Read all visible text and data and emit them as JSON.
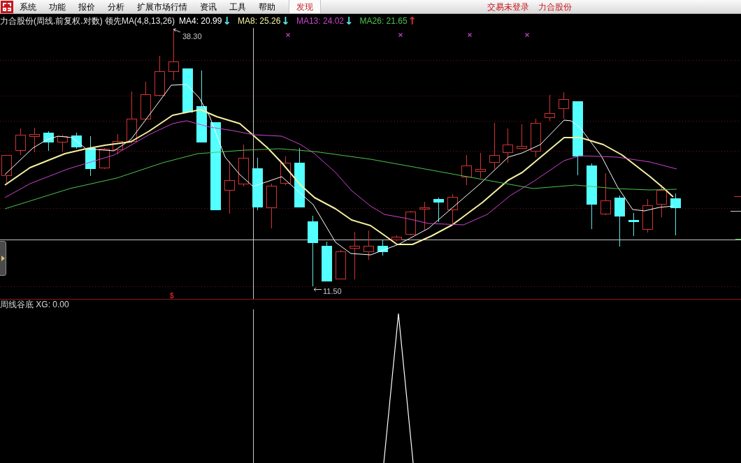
{
  "menu_bar": {
    "items": [
      {
        "label": "系统",
        "selected": false
      },
      {
        "label": "功能",
        "selected": false
      },
      {
        "label": "报价",
        "selected": false
      },
      {
        "label": "分析",
        "selected": false
      },
      {
        "label": "扩展市场行情",
        "selected": false
      },
      {
        "label": "资讯",
        "selected": false
      },
      {
        "label": "工具",
        "selected": false
      },
      {
        "label": "帮助",
        "selected": false
      },
      {
        "label": "发现",
        "selected": true
      }
    ],
    "status": [
      "交易未登录",
      "力合股份"
    ]
  },
  "chart_header": {
    "title": "力合股份(周线.前复权.对数) 领先MA(4,8,13,26)",
    "ma_values": [
      {
        "label": "MA4: 20.99",
        "color": "#ffffff",
        "arrow": {
          "text": "↓",
          "color": "#5ee6e6"
        }
      },
      {
        "label": "MA8: 25.26",
        "color": "#f5f0a0",
        "arrow": {
          "text": "↓",
          "color": "#5ee6e6"
        }
      },
      {
        "label": "MA13: 24.02",
        "color": "#cc44cc",
        "arrow": {
          "text": "↓",
          "color": "#5ee6e6"
        }
      },
      {
        "label": "MA26: 21.65",
        "color": "#4cc44c",
        "arrow": {
          "text": "↑",
          "color": "#e03030"
        }
      }
    ]
  },
  "main_chart": {
    "high_label": "38.30",
    "low_label": "11.50",
    "signal_marker": "$"
  },
  "indicator_pane": {
    "title": "周线谷底 XG: 0.00"
  }
}
